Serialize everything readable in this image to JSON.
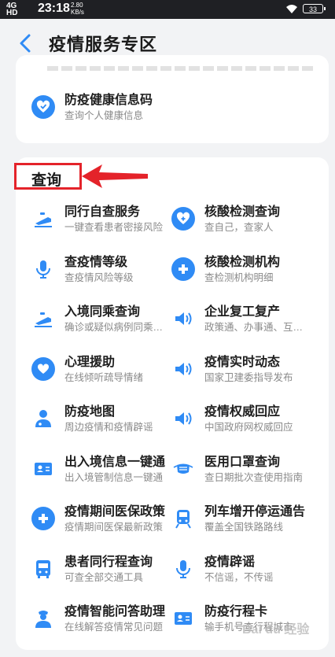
{
  "status_bar": {
    "network": "4G",
    "network_sub": "HD",
    "time": "23:18",
    "speed_value": "2.80",
    "speed_unit": "KB/s",
    "battery": "33"
  },
  "header": {
    "title": "疫情服务专区"
  },
  "top_card": {
    "item": {
      "title": "防疫健康信息码",
      "subtitle": "查询个人健康信息",
      "icon": "heart-shield-icon"
    }
  },
  "section": {
    "title": "查询"
  },
  "query_items": [
    {
      "title": "同行自查服务",
      "subtitle": "一键查看患者密接风险",
      "icon": "train-icon"
    },
    {
      "title": "核酸检测查询",
      "subtitle": "查自己，查家人",
      "icon": "heart-plus-icon"
    },
    {
      "title": "查疫情等级",
      "subtitle": "查疫情风险等级",
      "icon": "microphone-icon"
    },
    {
      "title": "核酸检测机构",
      "subtitle": "查检测机构明细",
      "icon": "medical-cross-icon"
    },
    {
      "title": "入境同乘查询",
      "subtitle": "确诊或疑似病例同乘…",
      "icon": "train-icon"
    },
    {
      "title": "企业复工复产",
      "subtitle": "政策通、办事通、互…",
      "icon": "speaker-icon"
    },
    {
      "title": "心理援助",
      "subtitle": "在线倾听疏导情绪",
      "icon": "heart-hands-icon"
    },
    {
      "title": "疫情实时动态",
      "subtitle": "国家卫建委指导发布",
      "icon": "speaker-icon"
    },
    {
      "title": "防疫地图",
      "subtitle": "周边疫情和疫情辟谣",
      "icon": "doctor-icon"
    },
    {
      "title": "疫情权威回应",
      "subtitle": "中国政府网权威回应",
      "icon": "speaker-icon"
    },
    {
      "title": "出入境信息一键通",
      "subtitle": "出入境管制信息一键通",
      "icon": "id-card-icon"
    },
    {
      "title": "医用口罩查询",
      "subtitle": "查日期批次查使用指南",
      "icon": "mask-icon"
    },
    {
      "title": "疫情期间医保政策",
      "subtitle": "疫情期间医保最新政策",
      "icon": "medical-cross-icon"
    },
    {
      "title": "列车增开停运通告",
      "subtitle": "覆盖全国铁路路线",
      "icon": "train-front-icon"
    },
    {
      "title": "患者同行程查询",
      "subtitle": "可查全部交通工具",
      "icon": "bus-icon"
    },
    {
      "title": "疫情辟谣",
      "subtitle": "不信谣，不传谣",
      "icon": "microphone-icon"
    },
    {
      "title": "疫情智能问答助理",
      "subtitle": "在线解答疫情常见问题",
      "icon": "nurse-icon"
    },
    {
      "title": "防疫行程卡",
      "subtitle": "输手机号查行程城市",
      "icon": "id-card-icon"
    }
  ],
  "colors": {
    "accent": "#2f8bf5",
    "highlight": "#e4232a",
    "background": "#f2f3f5"
  },
  "watermark": "Bai du 经验"
}
